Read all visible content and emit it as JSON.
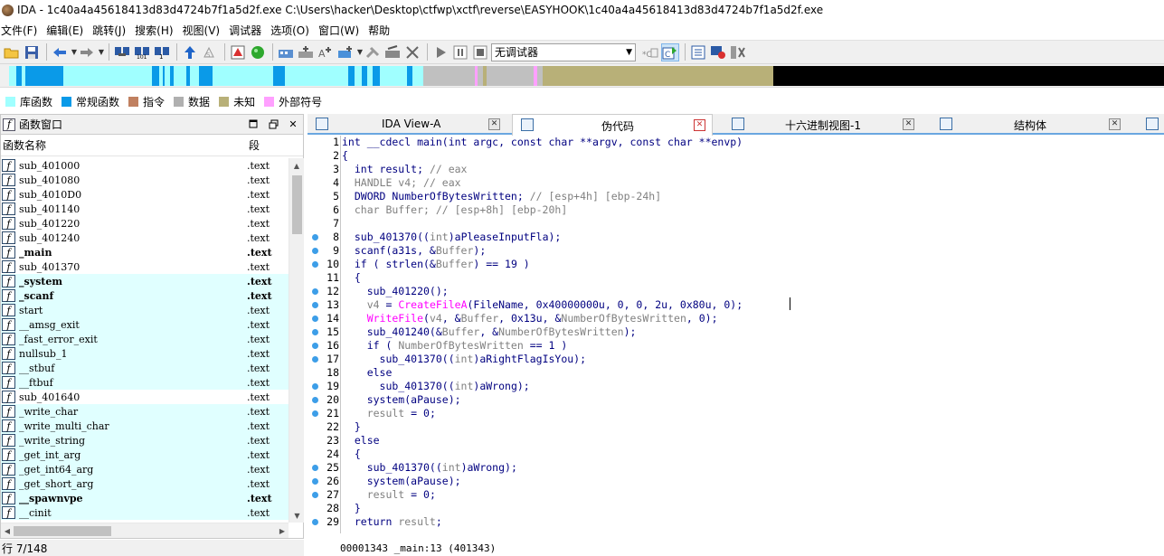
{
  "window": {
    "title": "IDA - 1c40a4a45618413d83d4724b7f1a5d2f.exe C:\\Users\\hacker\\Desktop\\ctfwp\\xctf\\reverse\\EASYHOOK\\1c40a4a45618413d83d4724b7f1a5d2f.exe"
  },
  "menu": {
    "items": [
      "文件(F)",
      "编辑(E)",
      "跳转(J)",
      "搜索(H)",
      "视图(V)",
      "调试器",
      "选项(O)",
      "窗口(W)",
      "帮助"
    ]
  },
  "toolbar": {
    "icons": [
      "open-icon",
      "save-icon",
      "back-icon",
      "forward-icon",
      "search-text-icon",
      "search-bin-icon",
      "search-imm-icon",
      "jump-up-icon",
      "hex-icon",
      "graph-icon",
      "run-icon",
      "create-code-icon",
      "create-data-icon",
      "create-string-icon",
      "create-struct-icon",
      "plugin-icon",
      "patch-icon",
      "undefine-icon",
      "play-icon",
      "pause-icon",
      "stop-icon",
      "breakpoint-icon",
      "trace-icon",
      "fn-list-icon",
      "flag-icon",
      "tools-icon"
    ],
    "debugger_select": "无调试器"
  },
  "nav_band": {
    "colors": {
      "library": "#a0ffff",
      "regular": "#0a9ae8",
      "instruction": "#c08060",
      "data": "#c0c0c0",
      "unexplored": "#b8b078",
      "external": "#ffa0ff",
      "gap": "#000000"
    }
  },
  "legend": [
    {
      "label": "库函数",
      "color": "#a0ffff"
    },
    {
      "label": "常规函数",
      "color": "#0a9ae8"
    },
    {
      "label": "指令",
      "color": "#c08060"
    },
    {
      "label": "数据",
      "color": "#b0b0b0"
    },
    {
      "label": "未知",
      "color": "#b8b078"
    },
    {
      "label": "外部符号",
      "color": "#ffa0ff"
    }
  ],
  "functions_panel": {
    "title": "函数窗口",
    "col_name": "函数名称",
    "col_segment": "段",
    "rows": [
      {
        "name": "sub_401000",
        "seg": ".text",
        "lib": false,
        "bold": false
      },
      {
        "name": "sub_401080",
        "seg": ".text",
        "lib": false,
        "bold": false
      },
      {
        "name": "sub_4010D0",
        "seg": ".text",
        "lib": false,
        "bold": false
      },
      {
        "name": "sub_401140",
        "seg": ".text",
        "lib": false,
        "bold": false
      },
      {
        "name": "sub_401220",
        "seg": ".text",
        "lib": false,
        "bold": false
      },
      {
        "name": "sub_401240",
        "seg": ".text",
        "lib": false,
        "bold": false
      },
      {
        "name": "_main",
        "seg": ".text",
        "lib": false,
        "bold": true
      },
      {
        "name": "sub_401370",
        "seg": ".text",
        "lib": false,
        "bold": false
      },
      {
        "name": "_system",
        "seg": ".text",
        "lib": true,
        "bold": true
      },
      {
        "name": "_scanf",
        "seg": ".text",
        "lib": true,
        "bold": true
      },
      {
        "name": "start",
        "seg": ".text",
        "lib": true,
        "bold": false
      },
      {
        "name": "__amsg_exit",
        "seg": ".text",
        "lib": true,
        "bold": false
      },
      {
        "name": "_fast_error_exit",
        "seg": ".text",
        "lib": true,
        "bold": false
      },
      {
        "name": "nullsub_1",
        "seg": ".text",
        "lib": true,
        "bold": false
      },
      {
        "name": "__stbuf",
        "seg": ".text",
        "lib": true,
        "bold": false
      },
      {
        "name": "__ftbuf",
        "seg": ".text",
        "lib": true,
        "bold": false
      },
      {
        "name": "sub_401640",
        "seg": ".text",
        "lib": false,
        "bold": false
      },
      {
        "name": "_write_char",
        "seg": ".text",
        "lib": true,
        "bold": false
      },
      {
        "name": "_write_multi_char",
        "seg": ".text",
        "lib": true,
        "bold": false
      },
      {
        "name": "_write_string",
        "seg": ".text",
        "lib": true,
        "bold": false
      },
      {
        "name": "_get_int_arg",
        "seg": ".text",
        "lib": true,
        "bold": false
      },
      {
        "name": "_get_int64_arg",
        "seg": ".text",
        "lib": true,
        "bold": false
      },
      {
        "name": "_get_short_arg",
        "seg": ".text",
        "lib": true,
        "bold": false
      },
      {
        "name": "__spawnvpe",
        "seg": ".text",
        "lib": true,
        "bold": true
      },
      {
        "name": "__cinit",
        "seg": ".text",
        "lib": true,
        "bold": false
      }
    ],
    "status": "行 7/148"
  },
  "tabs": [
    {
      "label": "IDA View-A",
      "active": false
    },
    {
      "label": "伪代码",
      "active": true
    },
    {
      "label": "十六进制视图-1",
      "active": false
    },
    {
      "label": "结构体",
      "active": false
    }
  ],
  "pseudocode": {
    "lines": [
      {
        "n": "1",
        "dot": false,
        "parts": [
          [
            "",
            "int __cdecl main(int argc, const char **argv, const char **envp)"
          ]
        ]
      },
      {
        "n": "2",
        "dot": false,
        "parts": [
          [
            "",
            "{"
          ]
        ]
      },
      {
        "n": "3",
        "dot": false,
        "parts": [
          [
            "",
            "  int result; "
          ],
          [
            "c-cm",
            "// eax"
          ]
        ]
      },
      {
        "n": "4",
        "dot": false,
        "parts": [
          [
            "c-gr",
            "  HANDLE v4; "
          ],
          [
            "c-cm",
            "// eax"
          ]
        ]
      },
      {
        "n": "5",
        "dot": false,
        "parts": [
          [
            "",
            "  DWORD NumberOfBytesWritten; "
          ],
          [
            "c-cm",
            "// [esp+4h] [ebp-24h]"
          ]
        ]
      },
      {
        "n": "6",
        "dot": false,
        "parts": [
          [
            "c-gr",
            "  char Buffer; "
          ],
          [
            "c-cm",
            "// [esp+8h] [ebp-20h]"
          ]
        ]
      },
      {
        "n": "7",
        "dot": false,
        "parts": [
          [
            "",
            ""
          ]
        ]
      },
      {
        "n": "8",
        "dot": true,
        "parts": [
          [
            "",
            "  sub_401370(("
          ],
          [
            "c-gr",
            "int"
          ],
          [
            "",
            ")aPleaseInputFla);"
          ]
        ]
      },
      {
        "n": "9",
        "dot": true,
        "parts": [
          [
            "",
            "  scanf(a31s, &"
          ],
          [
            "c-gr",
            "Buffer"
          ],
          [
            "",
            ");"
          ]
        ]
      },
      {
        "n": "10",
        "dot": true,
        "parts": [
          [
            "",
            "  if ( strlen(&"
          ],
          [
            "c-gr",
            "Buffer"
          ],
          [
            "",
            ") == 19 )"
          ]
        ]
      },
      {
        "n": "11",
        "dot": false,
        "parts": [
          [
            "",
            "  {"
          ]
        ]
      },
      {
        "n": "12",
        "dot": true,
        "parts": [
          [
            "",
            "    sub_401220();"
          ]
        ]
      },
      {
        "n": "13",
        "dot": true,
        "parts": [
          [
            "c-gr",
            "    v4"
          ],
          [
            "",
            " = "
          ],
          [
            "c-fn",
            "CreateFileA"
          ],
          [
            "",
            "(FileName, 0x40000000u, 0, 0, 2u, 0x80u, 0);"
          ]
        ]
      },
      {
        "n": "14",
        "dot": true,
        "parts": [
          [
            "c-fn",
            "    WriteFile"
          ],
          [
            "",
            "("
          ],
          [
            "c-gr",
            "v4"
          ],
          [
            "",
            ", &"
          ],
          [
            "c-gr",
            "Buffer"
          ],
          [
            "",
            ", 0x13u, &"
          ],
          [
            "c-gr",
            "NumberOfBytesWritten"
          ],
          [
            "",
            ", 0);"
          ]
        ]
      },
      {
        "n": "15",
        "dot": true,
        "parts": [
          [
            "",
            "    sub_401240(&"
          ],
          [
            "c-gr",
            "Buffer"
          ],
          [
            "",
            ", &"
          ],
          [
            "c-gr",
            "NumberOfBytesWritten"
          ],
          [
            "",
            ");"
          ]
        ]
      },
      {
        "n": "16",
        "dot": true,
        "parts": [
          [
            "",
            "    if ( "
          ],
          [
            "c-gr",
            "NumberOfBytesWritten"
          ],
          [
            "",
            " == 1 )"
          ]
        ]
      },
      {
        "n": "17",
        "dot": true,
        "parts": [
          [
            "",
            "      sub_401370(("
          ],
          [
            "c-gr",
            "int"
          ],
          [
            "",
            ")aRightFlagIsYou);"
          ]
        ]
      },
      {
        "n": "18",
        "dot": false,
        "parts": [
          [
            "",
            "    else"
          ]
        ]
      },
      {
        "n": "19",
        "dot": true,
        "parts": [
          [
            "",
            "      sub_401370(("
          ],
          [
            "c-gr",
            "int"
          ],
          [
            "",
            ")aWrong);"
          ]
        ]
      },
      {
        "n": "20",
        "dot": true,
        "parts": [
          [
            "",
            "    system(aPause);"
          ]
        ]
      },
      {
        "n": "21",
        "dot": true,
        "parts": [
          [
            "c-gr",
            "    result"
          ],
          [
            "",
            " = 0;"
          ]
        ]
      },
      {
        "n": "22",
        "dot": false,
        "parts": [
          [
            "",
            "  }"
          ]
        ]
      },
      {
        "n": "23",
        "dot": false,
        "parts": [
          [
            "",
            "  else"
          ]
        ]
      },
      {
        "n": "24",
        "dot": false,
        "parts": [
          [
            "",
            "  {"
          ]
        ]
      },
      {
        "n": "25",
        "dot": true,
        "parts": [
          [
            "",
            "    sub_401370(("
          ],
          [
            "c-gr",
            "int"
          ],
          [
            "",
            ")aWrong);"
          ]
        ]
      },
      {
        "n": "26",
        "dot": true,
        "parts": [
          [
            "",
            "    system(aPause);"
          ]
        ]
      },
      {
        "n": "27",
        "dot": true,
        "parts": [
          [
            "c-gr",
            "    result"
          ],
          [
            "",
            " = 0;"
          ]
        ]
      },
      {
        "n": "28",
        "dot": false,
        "parts": [
          [
            "",
            "  }"
          ]
        ]
      },
      {
        "n": "29",
        "dot": true,
        "parts": [
          [
            "",
            "  return "
          ],
          [
            "c-gr",
            "result"
          ],
          [
            "",
            ";"
          ]
        ]
      }
    ],
    "status": "00001343 _main:13 (401343)"
  }
}
